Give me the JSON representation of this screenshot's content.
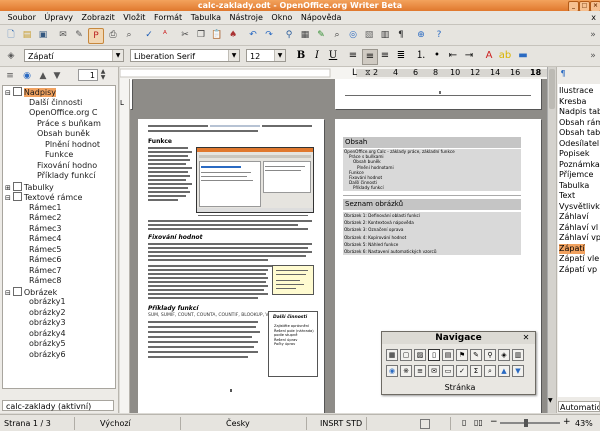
{
  "window": {
    "title": "calc-zaklady.odt - OpenOffice.org Writer Beta"
  },
  "menu": {
    "items": [
      "Soubor",
      "Úpravy",
      "Zobrazit",
      "Vložit",
      "Formát",
      "Tabulka",
      "Nástroje",
      "Okno",
      "Nápověda"
    ],
    "close": "x"
  },
  "formatting": {
    "paragraph_style": "Zápatí",
    "font_name": "Liberation Serif",
    "font_size": "12"
  },
  "navigator": {
    "spin_value": "1",
    "tree": [
      {
        "label": "Nadpisy",
        "level": 0,
        "expander": "⊟",
        "selected": true
      },
      {
        "label": "Další činnosti",
        "level": 1
      },
      {
        "label": "OpenOffice.org C",
        "level": 1
      },
      {
        "label": "Práce s buňkam",
        "level": 2
      },
      {
        "label": "Obsah buněk",
        "level": 2
      },
      {
        "label": "Plnění hodnot",
        "level": 3
      },
      {
        "label": "Funkce",
        "level": 3
      },
      {
        "label": "Fixování hodno",
        "level": 2
      },
      {
        "label": "Příklady funkcí",
        "level": 2
      },
      {
        "label": "Tabulky",
        "level": 0,
        "expander": "⊞"
      },
      {
        "label": "Textové rámce",
        "level": 0,
        "expander": "⊟"
      },
      {
        "label": "Rámec1",
        "level": 1
      },
      {
        "label": "Rámec2",
        "level": 1
      },
      {
        "label": "Rámec3",
        "level": 1
      },
      {
        "label": "Rámec4",
        "level": 1
      },
      {
        "label": "Rámec5",
        "level": 1
      },
      {
        "label": "Rámec6",
        "level": 1
      },
      {
        "label": "Rámec7",
        "level": 1
      },
      {
        "label": "Rámec8",
        "level": 1
      },
      {
        "label": "Obrázek",
        "level": 0,
        "expander": "⊟"
      },
      {
        "label": "obrázky1",
        "level": 1
      },
      {
        "label": "obrázky2",
        "level": 1
      },
      {
        "label": "obrázky3",
        "level": 1
      },
      {
        "label": "obrázky4",
        "level": 1
      },
      {
        "label": "obrázky5",
        "level": 1
      },
      {
        "label": "obrázky6",
        "level": 1
      }
    ],
    "document": "calc-zaklady (aktivní)"
  },
  "ruler": {
    "marks": [
      "2",
      "4",
      "6",
      "8",
      "10",
      "12",
      "14",
      "16",
      "18"
    ]
  },
  "left_page": {
    "heading_funkce": "Funkce",
    "heading_fixovani": "Fixování hodnot",
    "heading_priklady": "Příklady funkcí",
    "funcs_line": "SUM, SUMIF, COUNT, COUNTA, COUNTIF, BLOOKUP, VLOOKUP",
    "frame_title": "Další činnosti",
    "frame_items": [
      "Zajistěte oprávnění",
      "Řešení pole (náhrada) podle stupně",
      "Řešení úprav",
      "Počty úprav"
    ]
  },
  "right_page": {
    "obsah_title": "Obsah",
    "toc_lines": [
      "OpenOffice.org Calc - základy práce, základní funkce",
      "Práce s buňkami",
      "Obsah buněk",
      "Plnění hodnotami",
      "Funkce",
      "Fixování hodnot",
      "Další činnosti",
      "Příklady funkcí"
    ],
    "seznam_title": "Seznam obrázků",
    "fig_lines": [
      "Obrázek 1: Definování oblasti funkcí",
      "Obrázek 2: Kontextová nápověda",
      "Obrázek 3: Označení oprava",
      "Obrázek 4: Kopírování hodnot",
      "Obrázek 5: Náhled funkce",
      "Obrázek 6: Nastavení automatických vzorců"
    ]
  },
  "navigation_window": {
    "title": "Navigace",
    "close": "✕",
    "button_label": "Stránka"
  },
  "styles": {
    "items": [
      "Ilustrace",
      "Kresba",
      "Nadpis tab",
      "Obsah rám",
      "Obsah tab",
      "Odesílatel",
      "Popisek",
      "Poznámka",
      "Příjemce",
      "Tabulka",
      "Text",
      "Vysvětlivky",
      "Záhlaví",
      "Záhlaví vl",
      "Záhlaví vp",
      "Zápatí",
      "Zápatí vle",
      "Zápatí vp"
    ],
    "selected": "Zápatí",
    "filter": "Automatické"
  },
  "status": {
    "page": "Strana 1 / 3",
    "page_style": "Výchozí",
    "language": "Česky",
    "insert_mode": "INSRT",
    "selection_mode": "STD",
    "zoom": "43%",
    "zoom_fraction": 0.43
  },
  "colors": {
    "titlebar": "#e0782e",
    "selection": "#f1a260",
    "page_background": "#8e8c88"
  }
}
